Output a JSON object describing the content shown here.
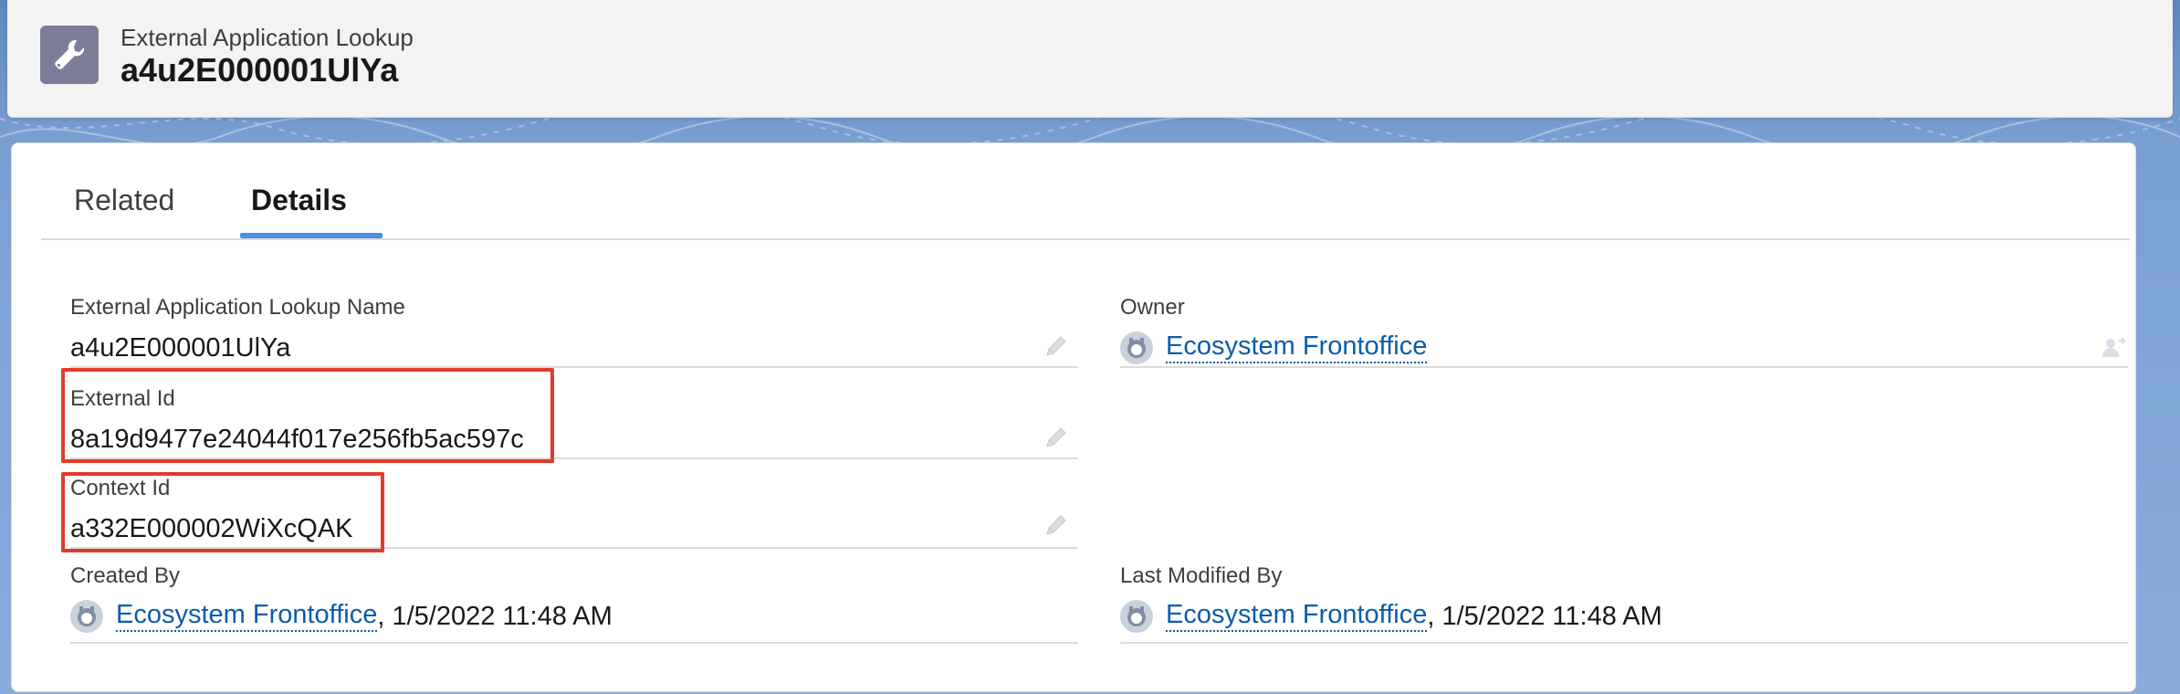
{
  "header": {
    "object_type": "External Application Lookup",
    "record_name": "a4u2E000001UlYa",
    "icon": "wrench-icon"
  },
  "tabs": [
    {
      "label": "Related",
      "active": false
    },
    {
      "label": "Details",
      "active": true
    }
  ],
  "fields": {
    "lookup_name": {
      "label": "External Application Lookup Name",
      "value": "a4u2E000001UlYa"
    },
    "owner": {
      "label": "Owner",
      "value": "Ecosystem Frontoffice"
    },
    "external_id": {
      "label": "External Id",
      "value": "8a19d9477e24044f017e256fb5ac597c"
    },
    "context_id": {
      "label": "Context Id",
      "value": "a332E000002WiXcQAK"
    },
    "created_by": {
      "label": "Created By",
      "user": "Ecosystem Frontoffice",
      "timestamp": ", 1/5/2022 11:48 AM"
    },
    "last_modified_by": {
      "label": "Last Modified By",
      "user": "Ecosystem Frontoffice",
      "timestamp": ", 1/5/2022 11:48 AM"
    }
  },
  "colors": {
    "accent": "#4a8fdf",
    "link": "#0b5cab",
    "highlight": "#e03c29",
    "icon_bg": "#7c7e99"
  }
}
